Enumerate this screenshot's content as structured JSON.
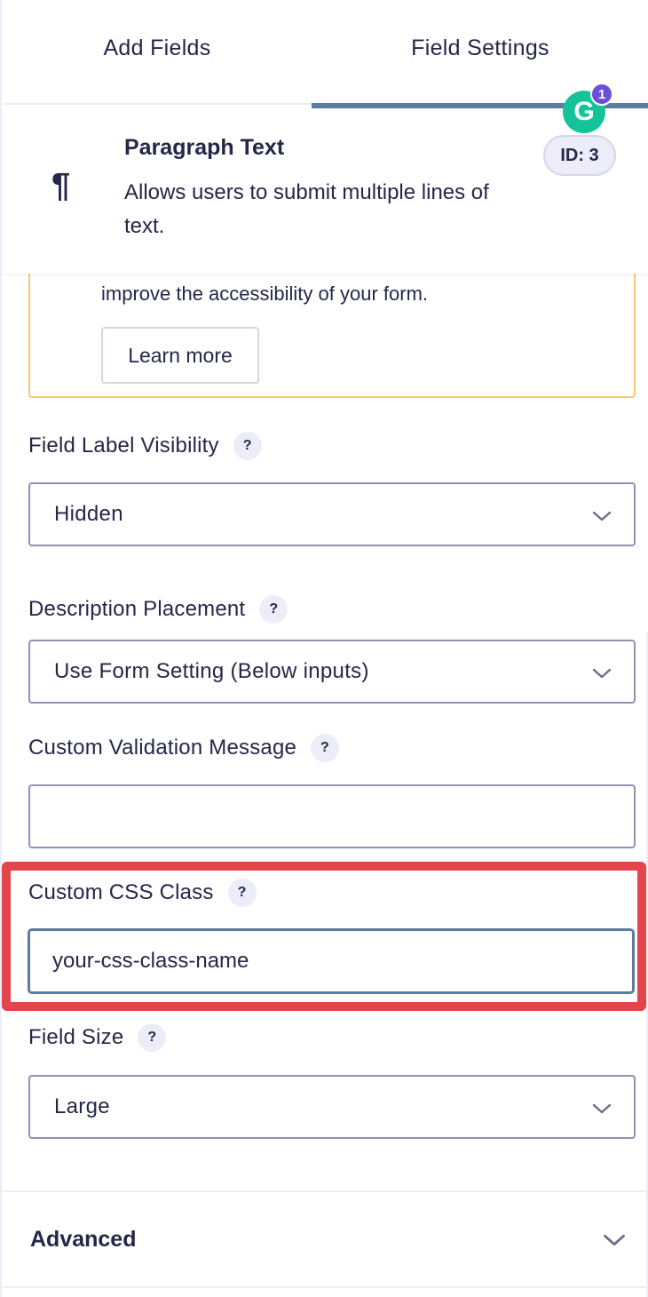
{
  "tabs": {
    "add_fields": "Add Fields",
    "field_settings": "Field Settings",
    "active": "field_settings"
  },
  "grammarly": {
    "icon": "grammarly-icon",
    "glyph": "G",
    "count": "1"
  },
  "field": {
    "icon": "pilcrow-icon",
    "glyph": "¶",
    "title": "Paragraph Text",
    "description": "Allows users to submit multiple lines of text.",
    "id_badge": "ID: 3"
  },
  "notice": {
    "text": "improve the accessibility of your form.",
    "learn_more": "Learn more"
  },
  "settings": {
    "label_visibility": {
      "label": "Field Label Visibility",
      "help": "?",
      "value": "Hidden"
    },
    "description_placement": {
      "label": "Description Placement",
      "help": "?",
      "value": "Use Form Setting (Below inputs)"
    },
    "custom_validation": {
      "label": "Custom Validation Message",
      "help": "?",
      "value": ""
    },
    "custom_css": {
      "label": "Custom CSS Class",
      "help": "?",
      "value": "your-css-class-name"
    },
    "field_size": {
      "label": "Field Size",
      "help": "?",
      "value": "Large"
    }
  },
  "advanced": {
    "label": "Advanced"
  },
  "colors": {
    "accent": "#5b7ba0",
    "highlight": "#e2454a",
    "notice_border": "#f8c96b",
    "text": "#242748",
    "grammarly": "#15c39a"
  }
}
